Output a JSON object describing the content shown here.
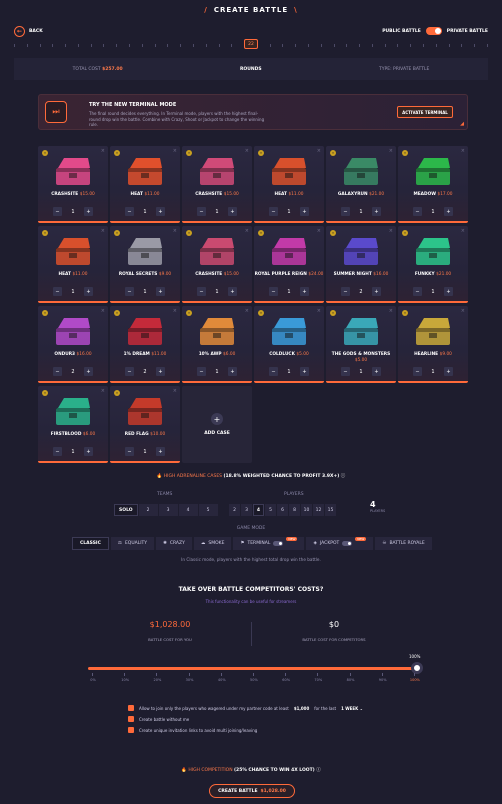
{
  "header": {
    "title": "CREATE BATTLE",
    "back_label": "BACK",
    "public_label": "PUBLIC BATTLE",
    "private_label": "PRIVATE BATTLE"
  },
  "rounds": {
    "current": "22",
    "label": "ROUNDS",
    "total_cost_label": "TOTAL COST",
    "total_cost": "$257.00",
    "type_label": "TYPE: PRIVATE BATTLE"
  },
  "promo": {
    "title": "TRY THE NEW TERMINAL MODE",
    "desc": "The final round decides everything. In Terminal mode, players with the highest final-round drop win the battle. Combine with Crazy, Shoot or Jackpot to change the winning rule.",
    "button": "ACTIVATE TERMINAL"
  },
  "cases": [
    {
      "name": "CRASHSITE",
      "price": "$15.00",
      "qty": "1",
      "color": "#e24a8a"
    },
    {
      "name": "HEAT",
      "price": "$11.00",
      "qty": "1",
      "color": "#e0502c"
    },
    {
      "name": "CRASHSITE",
      "price": "$15.00",
      "qty": "1",
      "color": "#d04a78"
    },
    {
      "name": "HEAT",
      "price": "$11.00",
      "qty": "1",
      "color": "#d8502c"
    },
    {
      "name": "GALAXYRUN",
      "price": "$21.00",
      "qty": "1",
      "color": "#3a8a66"
    },
    {
      "name": "MEADOW",
      "price": "$17.00",
      "qty": "1",
      "color": "#2cb84a"
    },
    {
      "name": "HEAT",
      "price": "$11.00",
      "qty": "1",
      "color": "#d8502c"
    },
    {
      "name": "ROYAL SECRETS",
      "price": "$9.00",
      "qty": "1",
      "color": "#9a9aa6"
    },
    {
      "name": "CRASHSITE",
      "price": "$15.00",
      "qty": "1",
      "color": "#c94a70"
    },
    {
      "name": "ROYAL PURPLE REIGN",
      "price": "$24.00",
      "qty": "1",
      "color": "#c23aa8"
    },
    {
      "name": "SUMMER NIGHT",
      "price": "$16.00",
      "qty": "2",
      "color": "#5a4acc"
    },
    {
      "name": "FUNKKY",
      "price": "$21.00",
      "qty": "1",
      "color": "#2cc48a"
    },
    {
      "name": "ONDUR3",
      "price": "$16.00",
      "qty": "2",
      "color": "#b04ac8"
    },
    {
      "name": "1% DREAM",
      "price": "$11.00",
      "qty": "2",
      "color": "#c42a3a"
    },
    {
      "name": "10% AWP",
      "price": "$6.00",
      "qty": "1",
      "color": "#e08a3a"
    },
    {
      "name": "COLDLUCK",
      "price": "$5.00",
      "qty": "1",
      "color": "#3a9ad8"
    },
    {
      "name": "THE GODS & MONSTERS",
      "price": "$5.00",
      "qty": "1",
      "color": "#3aa8b8"
    },
    {
      "name": "HEARLINE",
      "price": "$9.00",
      "qty": "1",
      "color": "#c8a83a"
    },
    {
      "name": "FIRSTBLOOD",
      "price": "$6.00",
      "qty": "1",
      "color": "#2ab08a"
    },
    {
      "name": "RED FLAG",
      "price": "$10.00",
      "qty": "1",
      "color": "#c43a2a"
    }
  ],
  "add_case_label": "ADD CASE",
  "adrenaline": {
    "label": "HIGH ADRENALINE CASES",
    "text": "(18.8% WEIGHTED CHANCE TO PROFIT 3.9X+)"
  },
  "teams": {
    "label": "TEAMS",
    "options": [
      "SOLO",
      "2",
      "3",
      "4",
      "5"
    ],
    "selected": "SOLO"
  },
  "players": {
    "label": "PLAYERS",
    "options": [
      "2",
      "3",
      "4",
      "5",
      "6",
      "8",
      "10",
      "12",
      "15"
    ],
    "selected": "4",
    "count": "4",
    "count_label": "PLAYERS"
  },
  "game_mode": {
    "label": "GAME MODE",
    "modes": [
      "CLASSIC",
      "EQUALITY",
      "CRAZY",
      "SMOKE",
      "TERMINAL",
      "JACKPOT",
      "BATTLE ROYALE"
    ],
    "new_tag": "NEW",
    "desc": "In Classic mode, players with the highest total drop win the battle."
  },
  "takeover": {
    "title": "TAKE OVER BATTLE COMPETITORS' COSTS?",
    "sub": "This functionality can be useful for streamers",
    "cost_you": "$1,028.00",
    "cost_you_label": "BATTLE COST FOR YOU",
    "cost_comp": "$0",
    "cost_comp_label": "BATTLE COST FOR COMPETITORS",
    "percent": "100%",
    "ticks": [
      "0%",
      "10%",
      "20%",
      "30%",
      "40%",
      "50%",
      "60%",
      "70%",
      "80%",
      "90%",
      "100%"
    ]
  },
  "options": [
    {
      "text": "Allow to join only the players who wagered under my partner code at least",
      "amount": "$1,000",
      "suffix": "for the last",
      "period": "1 WEEK"
    },
    {
      "text": "Create battle without me"
    },
    {
      "text": "Create unique invitation links to avoid multi joining/leaving"
    }
  ],
  "high_comp": {
    "label": "HIGH COMPETITION",
    "text": "(25% CHANCE TO WIN 4X LOOT)"
  },
  "create": {
    "label": "CREATE BATTLE",
    "price": "$1,028.00"
  }
}
